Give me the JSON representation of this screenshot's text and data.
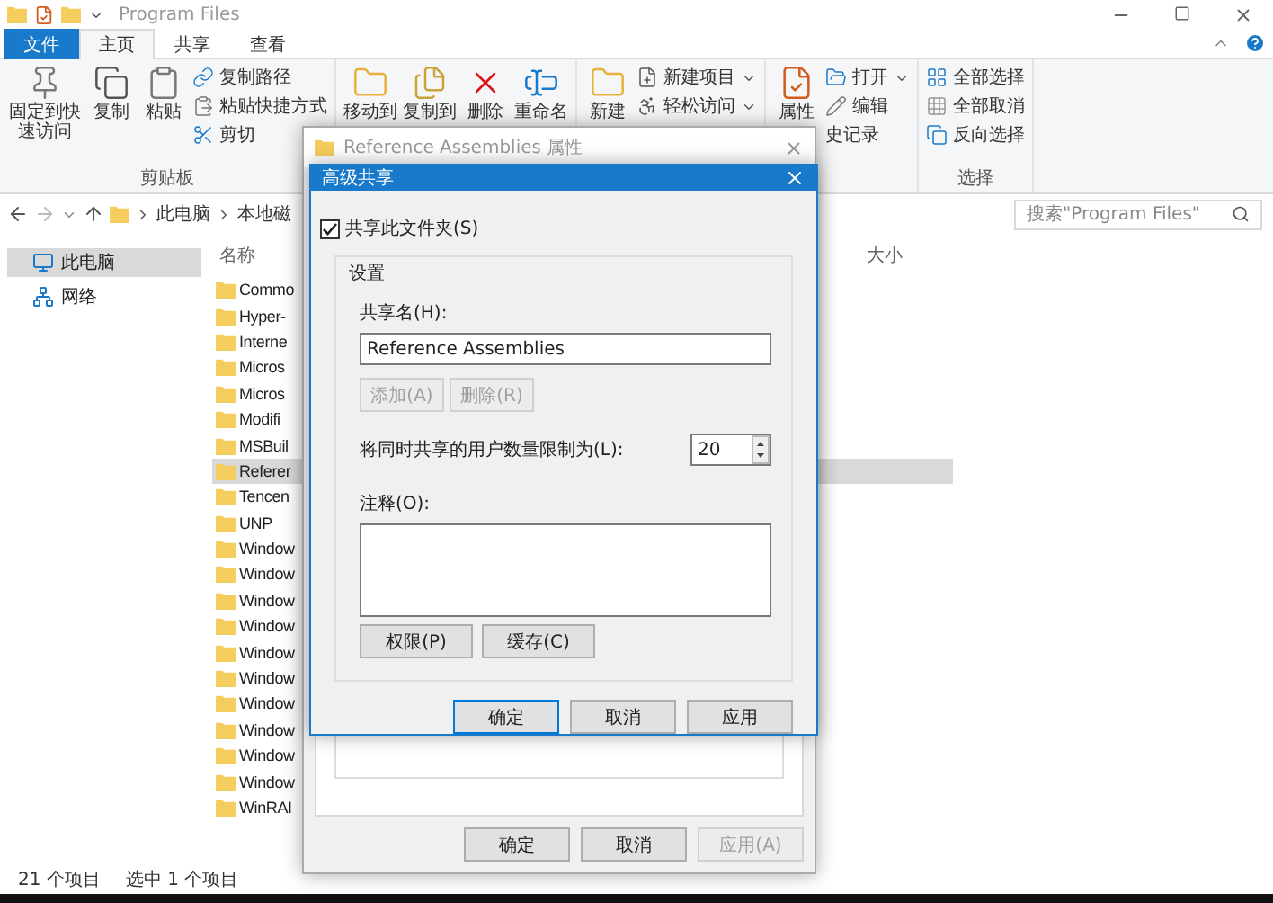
{
  "explorer": {
    "title": "Program Files",
    "tabs": [
      {
        "label": "文件",
        "kind": "file",
        "selected": false
      },
      {
        "label": "主页",
        "kind": "tab",
        "selected": true
      },
      {
        "label": "共享",
        "kind": "tab",
        "selected": false
      },
      {
        "label": "查看",
        "kind": "tab",
        "selected": false
      }
    ],
    "ribbon": [
      {
        "label": "剪贴板",
        "items": [
          {
            "kind": "large",
            "label": "固定到快速访问"
          },
          {
            "kind": "large",
            "label": "复制"
          },
          {
            "kind": "large",
            "label": "粘贴"
          },
          {
            "kind": "small",
            "label": "复制路径"
          },
          {
            "kind": "small",
            "label": "粘贴快捷方式"
          },
          {
            "kind": "small",
            "label": "剪切"
          }
        ]
      },
      {
        "items": [
          {
            "kind": "large",
            "label": "移动到"
          },
          {
            "kind": "large",
            "label": "复制到"
          },
          {
            "kind": "large",
            "label": "删除"
          },
          {
            "kind": "large",
            "label": "重命名"
          }
        ]
      },
      {
        "items": [
          {
            "kind": "large",
            "label": "新建"
          },
          {
            "kind": "small",
            "label": "新建项目",
            "has_menu": true
          },
          {
            "kind": "small",
            "label": "轻松访问",
            "has_menu": true
          }
        ]
      },
      {
        "items": [
          {
            "kind": "large",
            "label": "属性"
          },
          {
            "kind": "small",
            "label": "打开",
            "has_menu": true
          },
          {
            "kind": "small",
            "label": "编辑"
          },
          {
            "kind": "small",
            "label": "史记录"
          }
        ]
      },
      {
        "label": "选择",
        "items": [
          {
            "kind": "small",
            "label": "全部选择"
          },
          {
            "kind": "small",
            "label": "全部取消"
          },
          {
            "kind": "small",
            "label": "反向选择"
          }
        ]
      }
    ],
    "breadcrumb": [
      "此电脑",
      "本地磁"
    ],
    "search": {
      "placeholder": "搜索\"Program Files\""
    },
    "nav": [
      {
        "label": "此电脑",
        "selected": true
      },
      {
        "label": "网络",
        "selected": false
      }
    ],
    "columns": [
      "名称",
      "大小"
    ],
    "files": [
      {
        "name": "Commo",
        "selected": false
      },
      {
        "name": "Hyper-",
        "selected": false
      },
      {
        "name": "Interne",
        "selected": false
      },
      {
        "name": "Micros",
        "selected": false
      },
      {
        "name": "Micros",
        "selected": false
      },
      {
        "name": "Modifi",
        "selected": false
      },
      {
        "name": "MSBuil",
        "selected": false
      },
      {
        "name": "Referer",
        "selected": true
      },
      {
        "name": "Tencen",
        "selected": false
      },
      {
        "name": "UNP",
        "selected": false
      },
      {
        "name": "Window",
        "selected": false
      },
      {
        "name": "Window",
        "selected": false
      },
      {
        "name": "Window",
        "selected": false
      },
      {
        "name": "Window",
        "selected": false
      },
      {
        "name": "Window",
        "selected": false
      },
      {
        "name": "Window",
        "selected": false
      },
      {
        "name": "Window",
        "selected": false
      },
      {
        "name": "Window",
        "selected": false
      },
      {
        "name": "Window",
        "selected": false
      },
      {
        "name": "Window",
        "selected": false
      },
      {
        "name": "WinRAI",
        "selected": false
      }
    ],
    "status": [
      "21 个项目",
      "选中 1 个项目"
    ]
  },
  "properties_dialog": {
    "title": "Reference Assemblies 属性",
    "buttons": [
      {
        "label": "确定",
        "disabled": false
      },
      {
        "label": "取消",
        "disabled": false
      },
      {
        "label": "应用(A)",
        "disabled": true
      }
    ]
  },
  "sharing_dialog": {
    "title": "高级共享",
    "share_checkbox": {
      "label": "共享此文件夹(S)",
      "checked": true
    },
    "group_label": "设置",
    "share_name_label": "共享名(H):",
    "share_name": "Reference Assemblies",
    "name_buttons": [
      {
        "label": "添加(A)",
        "disabled": true
      },
      {
        "label": "删除(R)",
        "disabled": true
      }
    ],
    "limit_label": "将同时共享的用户数量限制为(L):",
    "limit": "20",
    "comment_label": "注释(O):",
    "extra_buttons": [
      {
        "label": "权限(P)",
        "disabled": false
      },
      {
        "label": "缓存(C)",
        "disabled": false
      }
    ],
    "buttons": [
      {
        "label": "确定",
        "default": true
      },
      {
        "label": "取消",
        "default": false
      },
      {
        "label": "应用",
        "default": false
      }
    ]
  }
}
